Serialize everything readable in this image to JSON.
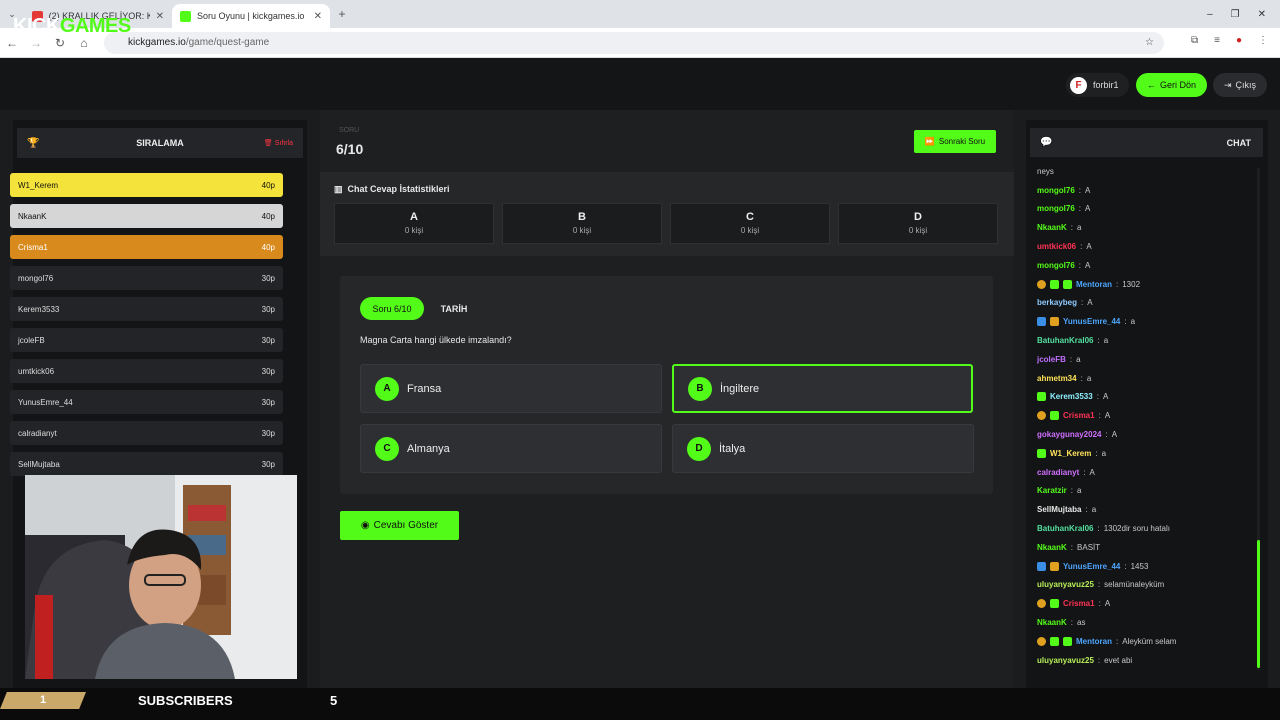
{
  "browser": {
    "tabs": [
      {
        "title": "(2) KRALLIK GELİYOR: Kurtuluş",
        "color": "#e53935"
      },
      {
        "title": "Soru Oyunu | kickgames.io",
        "color": "#53fc18"
      }
    ],
    "url_host": "kickgames.io",
    "url_path": "/game/quest-game"
  },
  "header": {
    "logo_kick": "KICK",
    "logo_games": "GAMES",
    "username": "forbir1",
    "back_label": "Geri Dön",
    "logout_label": "Çıkış"
  },
  "ranking": {
    "title": "SIRALAMA",
    "reset_label": "Sıfırla",
    "rows": [
      {
        "name": "W1_Kerem",
        "points": "40p",
        "bg": "#f3e33a",
        "fg": "#111"
      },
      {
        "name": "NkaanK",
        "points": "40p",
        "bg": "#d6d6d6",
        "fg": "#111"
      },
      {
        "name": "Crisma1",
        "points": "40p",
        "bg": "#d98a1c",
        "fg": "#fff"
      },
      {
        "name": "mongol76",
        "points": "30p"
      },
      {
        "name": "Kerem3533",
        "points": "30p"
      },
      {
        "name": "jcoleFB",
        "points": "30p"
      },
      {
        "name": "umtkick06",
        "points": "30p"
      },
      {
        "name": "YunusEmre_44",
        "points": "30p"
      },
      {
        "name": "calradianyt",
        "points": "30p"
      },
      {
        "name": "SellMujtaba",
        "points": "30p"
      }
    ]
  },
  "game": {
    "counter": "6/10",
    "next_label": "Sonraki Soru",
    "stats_title": "Chat Cevap İstatistikleri",
    "stats": [
      {
        "letter": "A",
        "count": "0 kişi"
      },
      {
        "letter": "B",
        "count": "0 kişi"
      },
      {
        "letter": "C",
        "count": "0 kişi"
      },
      {
        "letter": "D",
        "count": "0 kişi"
      }
    ],
    "question_pill": "Soru 6/10",
    "category": "TARİH",
    "question": "Magna Carta hangi ülkede imzalandı?",
    "options": [
      {
        "letter": "A",
        "text": "Fransa"
      },
      {
        "letter": "B",
        "text": "İngiltere"
      },
      {
        "letter": "C",
        "text": "Almanya"
      },
      {
        "letter": "D",
        "text": "İtalya"
      }
    ],
    "reveal_label": "Cevabı Göster"
  },
  "chat": {
    "title": "CHAT",
    "messages": [
      {
        "user": "",
        "text": "neys",
        "color": "#e8e8e8"
      },
      {
        "user": "mongol76",
        "text": "A",
        "color": "#53fc18"
      },
      {
        "user": "mongol76",
        "text": "A",
        "color": "#53fc18"
      },
      {
        "user": "NkaanK",
        "text": "a",
        "color": "#53fc18"
      },
      {
        "user": "umtkick06",
        "text": "A",
        "color": "#ff3355"
      },
      {
        "user": "mongol76",
        "text": "A",
        "color": "#53fc18"
      },
      {
        "user": "Mentoran",
        "text": "1302",
        "color": "#4da6ff",
        "badges": [
          "#e0a020",
          "#53fc18",
          "#53fc18"
        ]
      },
      {
        "user": "berkaybeg",
        "text": "A",
        "color": "#8ecbff"
      },
      {
        "user": "YunusEmre_44",
        "text": "a",
        "color": "#4da6ff",
        "badges": [
          "#3a8ee6",
          "#e0a020"
        ]
      },
      {
        "user": "BatuhanKral06",
        "text": "a",
        "color": "#53e0a0"
      },
      {
        "user": "jcoleFB",
        "text": "a",
        "color": "#c070ff"
      },
      {
        "user": "ahmetm34",
        "text": "a",
        "color": "#ffe35a"
      },
      {
        "user": "Kerem3533",
        "text": "A",
        "color": "#8ef0ff",
        "badges": [
          "#53fc18"
        ]
      },
      {
        "user": "Crisma1",
        "text": "A",
        "color": "#ff3355",
        "badges": [
          "#e0a020",
          "#53fc18"
        ]
      },
      {
        "user": "gokaygunay2024",
        "text": "A",
        "color": "#d070ff"
      },
      {
        "user": "W1_Kerem",
        "text": "a",
        "color": "#ffe35a",
        "badges": [
          "#53fc18"
        ]
      },
      {
        "user": "calradianyt",
        "text": "A",
        "color": "#d070ff"
      },
      {
        "user": "Karatzir",
        "text": "a",
        "color": "#53fc18"
      },
      {
        "user": "SellMujtaba",
        "text": "a",
        "color": "#e8e8e8"
      },
      {
        "user": "BatuhanKral06",
        "text": "1302dir soru hatalı",
        "color": "#53e0a0"
      },
      {
        "user": "NkaanK",
        "text": "BASİT",
        "color": "#53fc18"
      },
      {
        "user": "YunusEmre_44",
        "text": "1453",
        "color": "#4da6ff",
        "badges": [
          "#3a8ee6",
          "#e0a020"
        ]
      },
      {
        "user": "uluyanyavuz25",
        "text": "selamünaleyküm",
        "color": "#b8f05a"
      },
      {
        "user": "Crisma1",
        "text": "A",
        "color": "#ff3355",
        "badges": [
          "#e0a020",
          "#53fc18"
        ]
      },
      {
        "user": "NkaanK",
        "text": "as",
        "color": "#53fc18"
      },
      {
        "user": "Mentoran",
        "text": "Aleyküm selam",
        "color": "#4da6ff",
        "badges": [
          "#e0a020",
          "#53fc18",
          "#53fc18"
        ]
      },
      {
        "user": "uluyanyavuz25",
        "text": "evet abi",
        "color": "#b8f05a"
      }
    ]
  },
  "overlay": {
    "left_number": "1",
    "subscribers_label": "SUBSCRIBERS",
    "subscribers_count": "5"
  },
  "colors": {
    "accent": "#53fc18"
  }
}
